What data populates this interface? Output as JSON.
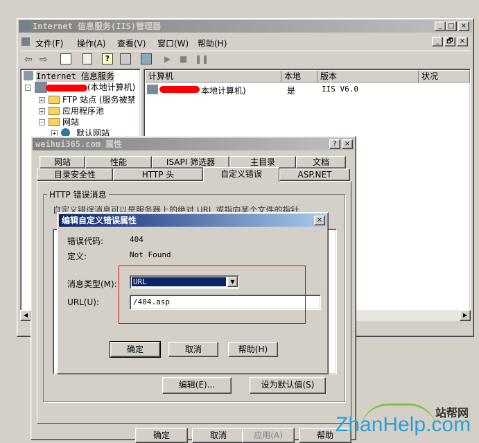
{
  "main_window": {
    "title": "Internet 信息服务(IIS)管理器",
    "menu": [
      "文件(F)",
      "操作(A)",
      "查看(V)",
      "窗口(W)",
      "帮助(H)"
    ],
    "caption_buttons": [
      "_",
      "□",
      "×"
    ],
    "mdi_buttons": [
      "_",
      "🗗",
      "×"
    ],
    "tree": {
      "root": "Internet 信息服务",
      "computer_suffix": "(本地计算机)",
      "items": [
        "FTP 站点 (服务被禁",
        "应用程序池",
        "网站",
        "默认网站"
      ],
      "expanders": [
        "+",
        "+",
        "-",
        "+"
      ]
    },
    "list_headers": [
      "计算机",
      "本地",
      "版本",
      "状况"
    ],
    "list_row": {
      "computer": "本地计算机)",
      "local": "是",
      "version": "IIS V6.0",
      "status": ""
    },
    "status_fragment": "□□□ 1"
  },
  "props_dialog": {
    "title": "weihui365.com 属性",
    "caption_buttons": [
      "?",
      "×"
    ],
    "tabs_row1": [
      "网站",
      "性能",
      "ISAPI 筛选器",
      "主目录",
      "文档"
    ],
    "tabs_row2": [
      "目录安全性",
      "HTTP 头",
      "自定义错误",
      "ASP.NET"
    ],
    "group_label": "HTTP 错误消息",
    "description": "自定义错误消息可以是服务器上的绝对 URL 或指向某个文件的指针",
    "edit_button": "编辑(E)...",
    "default_button": "设为默认值(S)",
    "bottom_buttons": [
      "确定",
      "取消",
      "应用(A)",
      "帮助"
    ]
  },
  "edit_dialog": {
    "title": "编辑自定义错误属性",
    "close": "×",
    "error_code_label": "错误代码:",
    "error_code_value": "404",
    "definition_label": "定义:",
    "definition_value": "Not Found",
    "message_type_label": "消息类型(M):",
    "message_type_value": "URL",
    "url_label": "URL(U):",
    "url_value": "/404.asp",
    "buttons": [
      "确定",
      "取消",
      "帮助(H)"
    ]
  },
  "watermark": {
    "brand": "ZhanHelp.com",
    "cn": "站帮网"
  },
  "colors": {
    "highlight_box": "#e60000",
    "titlebar_active": "#0a246a",
    "titlebar_inactive": "#808080"
  }
}
